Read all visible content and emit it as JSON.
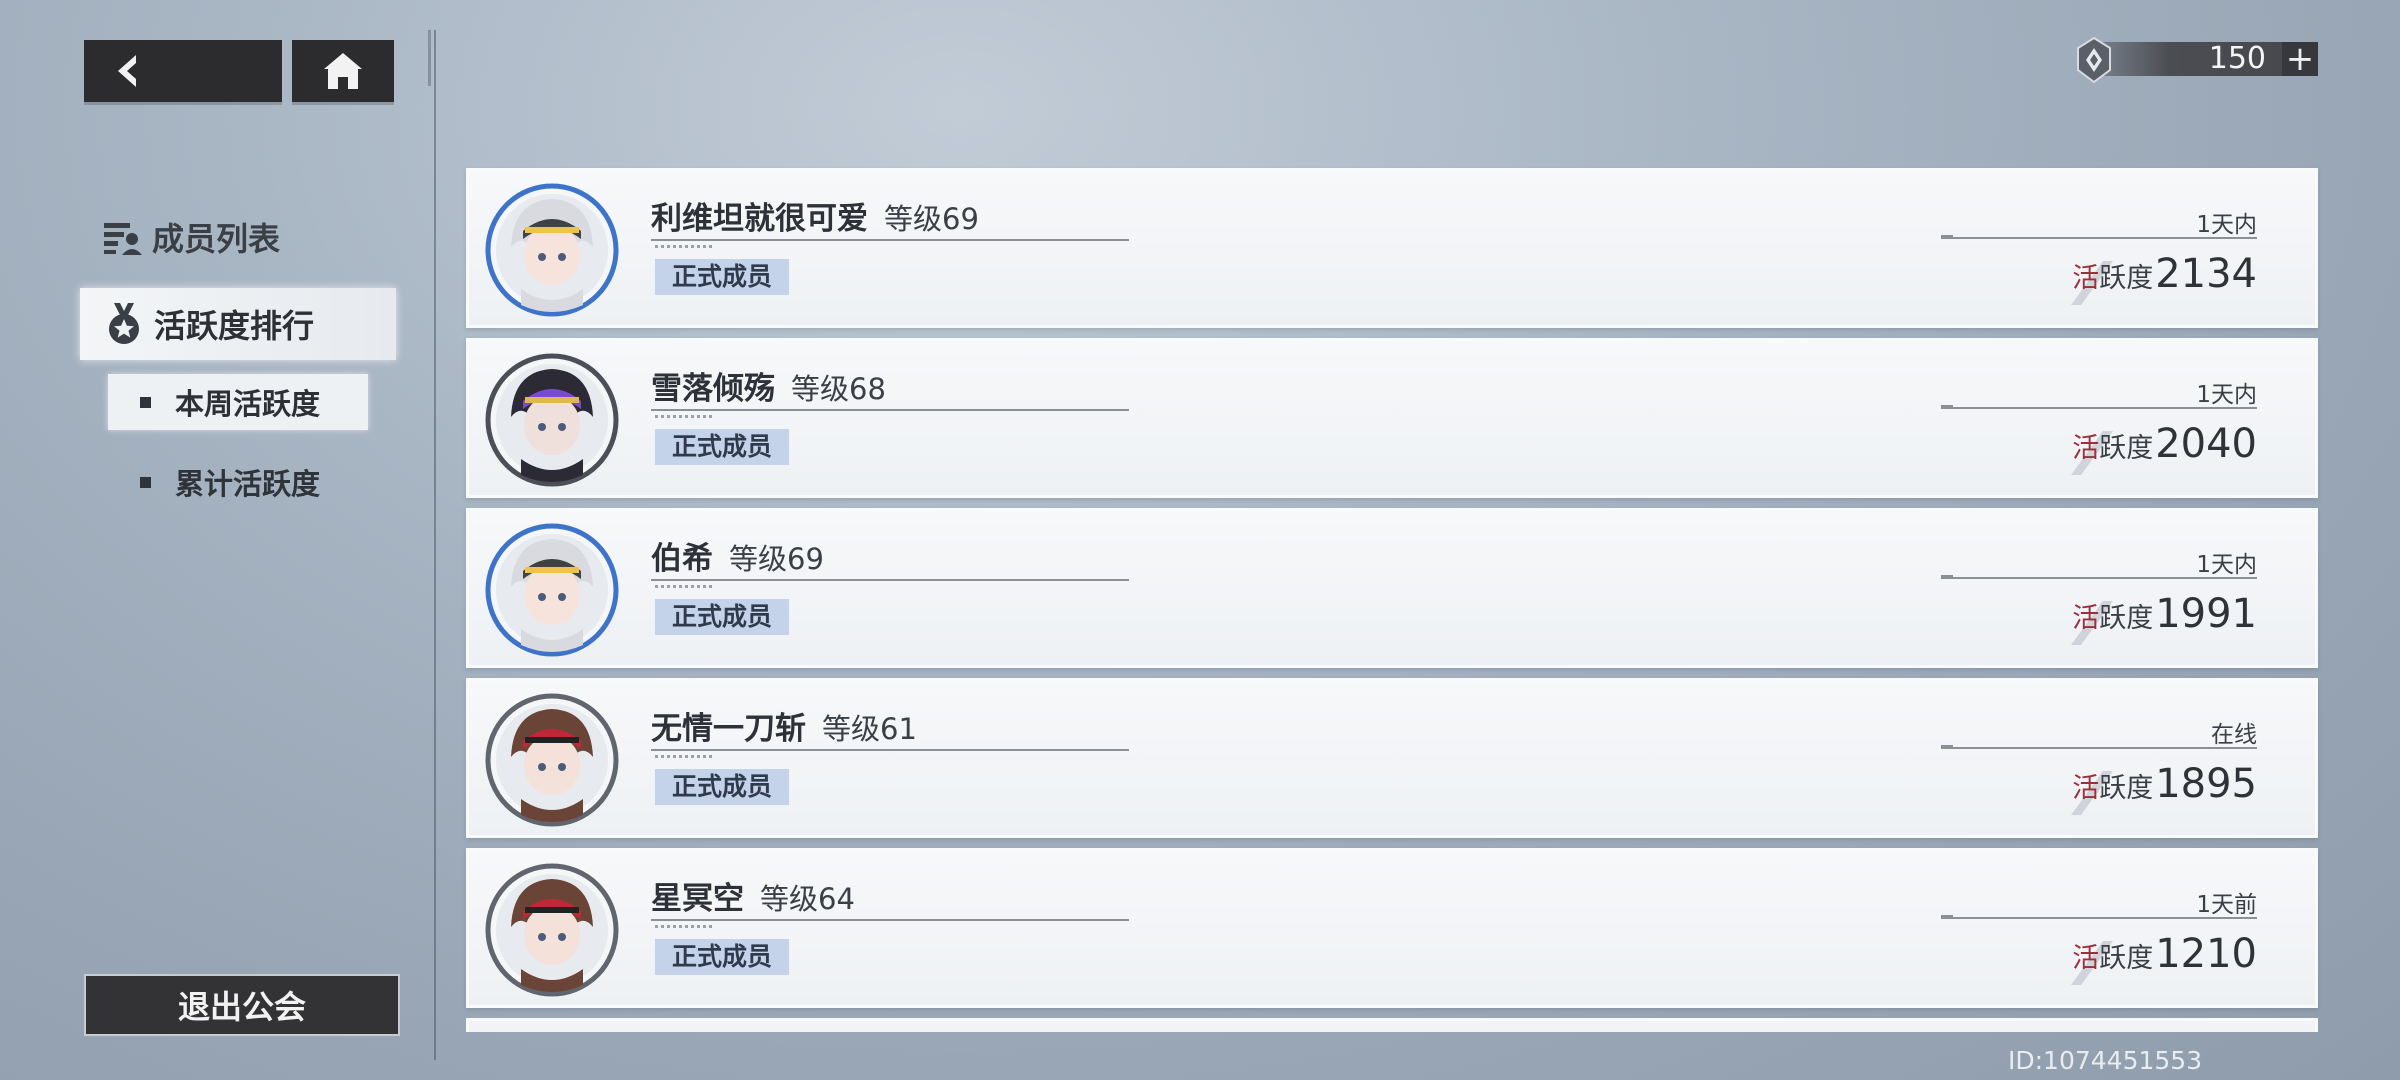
{
  "nav": {
    "back_icon": "back-arrow-icon",
    "home_icon": "home-icon"
  },
  "currency": {
    "value": "150",
    "plus": "+",
    "icon": "gem-icon"
  },
  "sidebar": {
    "member_list_label": "成员列表",
    "activity_ranking_label": "活跃度排行",
    "sub_items": [
      {
        "label": "本周活跃度",
        "selected": true
      },
      {
        "label": "累计活跃度",
        "selected": false
      }
    ],
    "exit_label": "退出公会"
  },
  "members": [
    {
      "name": "利维坦就很可爱",
      "level": "等级69",
      "role": "正式成员",
      "last_seen": "1天内",
      "activity_label_hi": "活",
      "activity_label_rest": "跃度",
      "activity": "2134",
      "avatar": "white-hair-goggles"
    },
    {
      "name": "雪落倾殇",
      "level": "等级68",
      "role": "正式成员",
      "last_seen": "1天内",
      "activity_label_hi": "活",
      "activity_label_rest": "跃度",
      "activity": "2040",
      "avatar": "dark-hair-purple"
    },
    {
      "name": "伯希",
      "level": "等级69",
      "role": "正式成员",
      "last_seen": "1天内",
      "activity_label_hi": "活",
      "activity_label_rest": "跃度",
      "activity": "1991",
      "avatar": "white-hair-goggles"
    },
    {
      "name": "无情一刀斩",
      "level": "等级61",
      "role": "正式成员",
      "last_seen": "在线",
      "activity_label_hi": "活",
      "activity_label_rest": "跃度",
      "activity": "1895",
      "avatar": "brown-hair-headband"
    },
    {
      "name": "星冥空",
      "level": "等级64",
      "role": "正式成员",
      "last_seen": "1天前",
      "activity_label_hi": "活",
      "activity_label_rest": "跃度",
      "activity": "1210",
      "avatar": "brown-hair-headband"
    }
  ],
  "footer": {
    "user_id": "ID:1074451553"
  }
}
